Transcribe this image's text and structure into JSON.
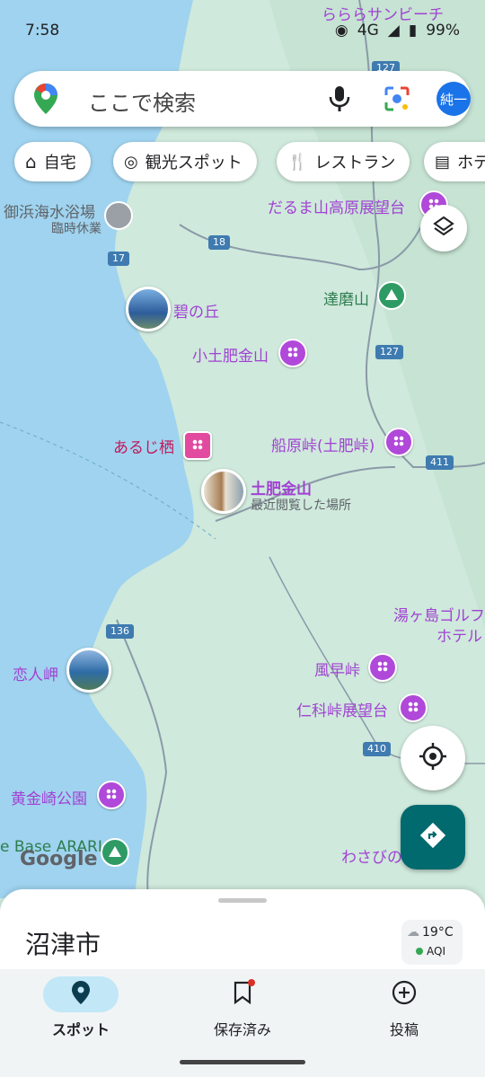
{
  "status": {
    "time": "7:58",
    "network": "4G",
    "battery": "99%"
  },
  "search": {
    "placeholder": "ここで検索",
    "avatar": "純一"
  },
  "chips": [
    {
      "icon": "home-icon",
      "label": "自宅"
    },
    {
      "icon": "camera-icon",
      "label": "観光スポット"
    },
    {
      "icon": "restaurant-icon",
      "label": "レストラン"
    },
    {
      "icon": "hotel-icon",
      "label": "ホテ"
    }
  ],
  "map": {
    "labels": {
      "top_place": "らららサンビーチ",
      "darumayama": "だるま山高原展望台",
      "gohama": "御浜海水浴場",
      "gohama_status": "臨時休業",
      "midori": "碧の丘",
      "tatsuma": "達磨山",
      "kotoi": "小土肥金山",
      "aruji": "あるじ栖",
      "funabara": "船原峠(土肥峠)",
      "toi_kinzan": "土肥金山",
      "toi_kinzan_sub": "最近閲覧した場所",
      "yugashima_golf_1": "湯ヶ島ゴルフ",
      "yugashima_golf_2": "ホテル",
      "koibito": "恋人岬",
      "kazahaya": "風早峠",
      "nishina": "仁科峠展望台",
      "koganezaki": "黄金崎公園",
      "base_arari": "e Base ARARI",
      "wasabi": "わさびの",
      "google": "Google"
    },
    "routes": [
      "127",
      "18",
      "17",
      "127",
      "411",
      "136",
      "410"
    ]
  },
  "sheet": {
    "title": "沼津市",
    "temp": "19°C",
    "aqi": "AQI"
  },
  "nav": [
    {
      "label": "スポット",
      "icon": "location-pin-icon",
      "active": true
    },
    {
      "label": "保存済み",
      "icon": "bookmark-icon",
      "active": false
    },
    {
      "label": "投稿",
      "icon": "add-circle-icon",
      "active": false
    }
  ],
  "colors": {
    "sea": "#9fd3ef",
    "land": "#cfe9dc",
    "poi": "#b049d9",
    "accent": "#1a73e8",
    "nav_active": "#c2e7f7"
  }
}
